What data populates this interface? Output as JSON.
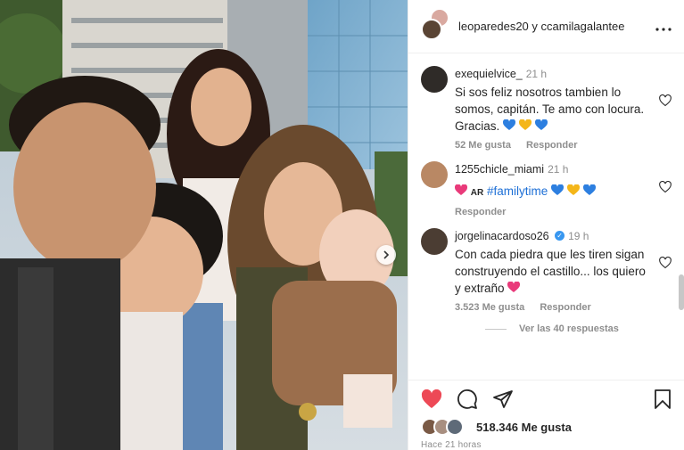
{
  "post": {
    "header": {
      "user1": "leoparedes20",
      "joiner": "y",
      "user2": "ccamilagalantee"
    },
    "comments": [
      {
        "username": "exequielvice_",
        "time": "21 h",
        "text": "Si sos feliz nosotros tambien lo somos, capitán. Te amo con locura. Gracias.",
        "likes": "52 Me gusta",
        "reply": "Responder"
      },
      {
        "username": "1255chicle_miami",
        "time": "21 h",
        "flag_text": "AR",
        "hashtag": "#familytime",
        "reply": "Responder"
      },
      {
        "username": "jorgelinacardoso26",
        "time": "19 h",
        "text": "Con cada piedra que les tiren sigan construyendo el castillo... los quiero y extraño",
        "likes": "3.523 Me gusta",
        "reply": "Responder",
        "view_replies": "Ver las 40 respuestas"
      }
    ],
    "likes_count": "518.346",
    "likes_label": "Me gusta",
    "posted": "Hace 21 horas"
  },
  "colors": {
    "like_red": "#ed4956",
    "link_blue": "#1d6fd6",
    "muted": "#8e8e8e"
  },
  "icons": [
    "more-icon",
    "heart-icon",
    "comment-icon",
    "share-icon",
    "bookmark-icon",
    "chevron-right-icon",
    "verified-icon"
  ]
}
